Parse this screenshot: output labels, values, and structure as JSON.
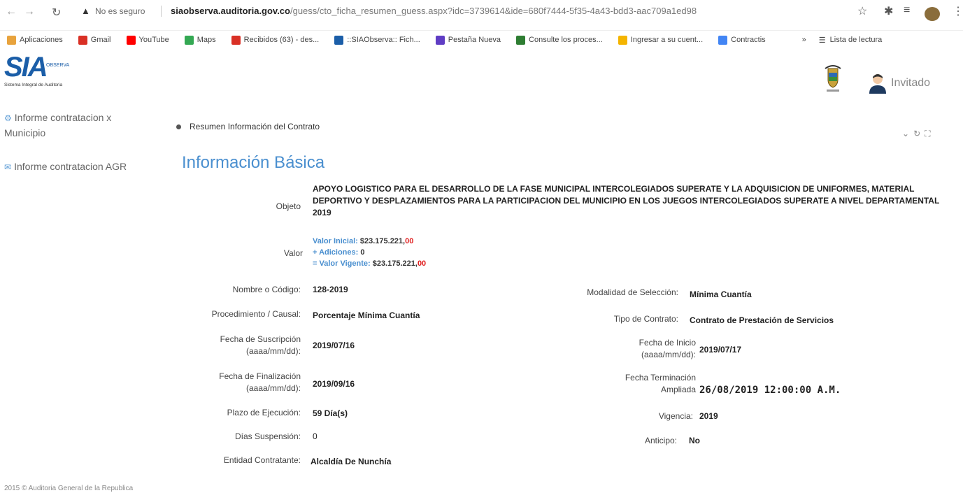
{
  "browser": {
    "insecure_label": "No es seguro",
    "url_domain": "siaobserva.auditoria.gov.co",
    "url_path": "/guess/cto_ficha_resumen_guess.aspx?idc=3739614&ide=680f7444-5f35-4a43-bdd3-aac709a1ed98",
    "bookmarks": [
      {
        "label": "Aplicaciones",
        "icon": "apps-icon",
        "color": "#e8a33d"
      },
      {
        "label": "Gmail",
        "icon": "gmail-icon",
        "color": "#d93025"
      },
      {
        "label": "YouTube",
        "icon": "youtube-icon",
        "color": "#ff0000"
      },
      {
        "label": "Maps",
        "icon": "maps-icon",
        "color": "#34a853"
      },
      {
        "label": "Recibidos (63) - des...",
        "icon": "gmail-icon",
        "color": "#d93025"
      },
      {
        "label": "::SIAObserva:: Fich...",
        "icon": "sia-icon",
        "color": "#1b5ea8"
      },
      {
        "label": "Pestaña Nueva",
        "icon": "globe-icon",
        "color": "#5f3dc4"
      },
      {
        "label": "Consulte los proces...",
        "icon": "login-icon",
        "color": "#2e7d32"
      },
      {
        "label": "Ingresar a su cuent...",
        "icon": "bank-icon",
        "color": "#f4b400"
      },
      {
        "label": "Contractis",
        "icon": "gear-icon",
        "color": "#4285f4"
      }
    ],
    "reading_list": "Lista de lectura"
  },
  "header": {
    "logo_text": "SIA",
    "logo_obs": "OBSERVA",
    "logo_subtitle": "Sistema Integral de Auditoria",
    "user_name": "Invitado"
  },
  "sidebar": {
    "items": [
      {
        "label": "Informe contratacion x Municipio"
      },
      {
        "label": "Informe contratacion AGR"
      }
    ]
  },
  "main": {
    "breadcrumb": "Resumen Información del Contrato",
    "title": "Información Básica",
    "objeto_label": "Objeto",
    "objeto_value": "APOYO LOGISTICO PARA EL DESARROLLO DE LA FASE MUNICIPAL INTERCOLEGIADOS SUPERATE Y LA ADQUISICION DE UNIFORMES, MATERIAL DEPORTIVO Y DESPLAZAMIENTOS PARA LA PARTICIPACION DEL MUNICIPIO EN LOS JUEGOS INTERCOLEGIADOS SUPERATE A NIVEL DEPARTAMENTAL 2019",
    "valor_label": "Valor",
    "valor_inicial_label": "Valor Inicial:",
    "valor_inicial": "$23.175.221,",
    "valor_inicial_cents": "00",
    "adiciones_label": "+ Adiciones:",
    "adiciones": "0",
    "valor_vigente_label": "= Valor Vigente:",
    "valor_vigente": "$23.175.221,",
    "valor_vigente_cents": "00",
    "left_fields": [
      {
        "label": "Nombre o Código:",
        "value": "128-2019"
      },
      {
        "label": "Procedimiento / Causal:",
        "value": "Porcentaje Mínima Cuantía"
      },
      {
        "label": "Fecha de Suscripción (aaaa/mm/dd):",
        "value": "2019/07/16"
      },
      {
        "label": "Fecha de Finalización (aaaa/mm/dd):",
        "value": "2019/09/16"
      },
      {
        "label": "Plazo de Ejecución:",
        "value": "59 Día(s)"
      },
      {
        "label": "Días Suspensión:",
        "value": "0"
      },
      {
        "label": "Entidad Contratante:",
        "value": "Alcaldía De Nunchía"
      }
    ],
    "right_fields": [
      {
        "label": "Modalidad de Selección:",
        "value": "Mínima Cuantía"
      },
      {
        "label": "Tipo de Contrato:",
        "value": "Contrato de Prestación de Servicios"
      },
      {
        "label": "Fecha de Inicio (aaaa/mm/dd):",
        "value": "2019/07/17"
      },
      {
        "label": "Fecha Terminación Ampliada",
        "value": "26/08/2019 12:00:00 A.M."
      },
      {
        "label": "Vigencia:",
        "value": "2019"
      },
      {
        "label": "Anticipo:",
        "value": "No"
      }
    ]
  },
  "footer": {
    "text": "2015 © Auditoria General de la Republica"
  }
}
